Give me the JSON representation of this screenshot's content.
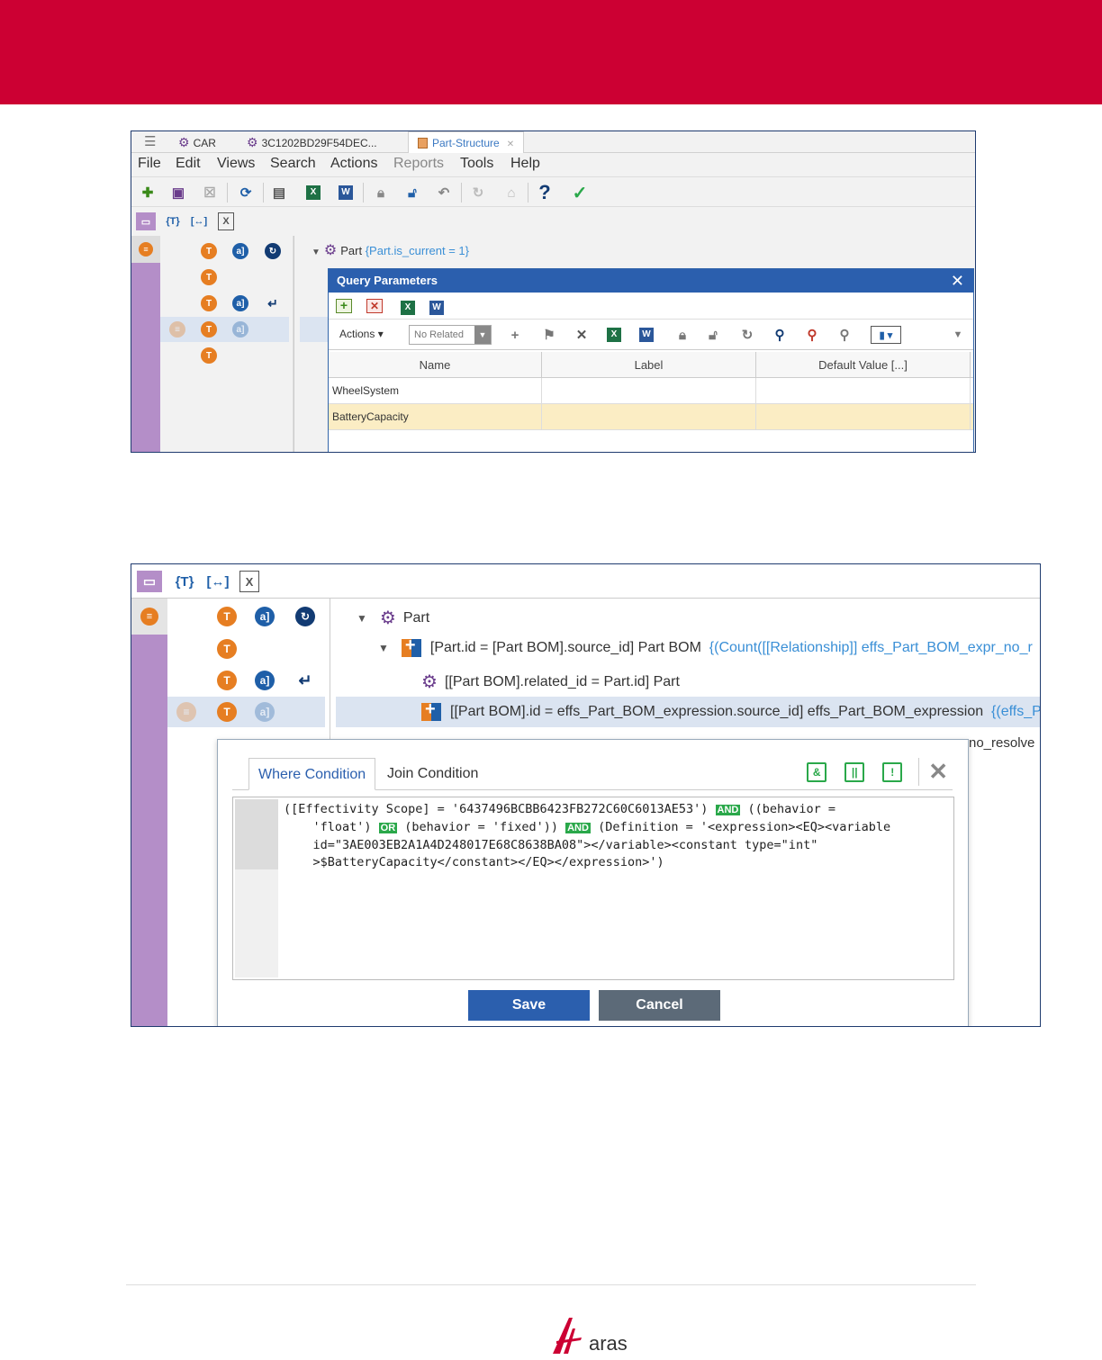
{
  "shot1": {
    "tabs": [
      {
        "label": "CAR"
      },
      {
        "label": "3C1202BD29F54DEC..."
      },
      {
        "label": "Part-Structure"
      }
    ],
    "menu": [
      "File",
      "Edit",
      "Views",
      "Search",
      "Actions",
      "Reports",
      "Tools",
      "Help"
    ],
    "tree_root": {
      "label": "Part",
      "condition": "{Part.is_current = 1}"
    },
    "dialog": {
      "title": "Query Parameters",
      "actions_label": "Actions",
      "no_related": "No Related",
      "columns": [
        "Name",
        "Label",
        "Default Value [...]"
      ],
      "rows": [
        {
          "name": "WheelSystem",
          "label": "",
          "default": ""
        },
        {
          "name": "BatteryCapacity",
          "label": "",
          "default": ""
        }
      ]
    }
  },
  "shot2": {
    "tree": [
      {
        "prefix": "",
        "label": "Part",
        "suffix": ""
      },
      {
        "prefix": "[Part.id = [Part BOM].source_id]",
        "label": "Part BOM",
        "suffix": "{(Count([[Relationship]] effs_Part_BOM_expr_no_r"
      },
      {
        "prefix": "[[Part BOM].related_id = Part.id]",
        "label": "Part",
        "suffix": ""
      },
      {
        "prefix": "[[Part BOM].id = effs_Part_BOM_expression.source_id]",
        "label": "effs_Part_BOM_expression",
        "suffix": "{(effs_P"
      },
      {
        "prefix": "",
        "label": "no_resolve",
        "suffix": ""
      }
    ],
    "popup": {
      "tab_where": "Where Condition",
      "tab_join": "Join Condition",
      "code": {
        "l1a": "([Effectivity Scope] = '6437496BCBB6423FB272C60C6013AE53') ",
        "and1": "AND",
        "l1b": " ((behavior =",
        "l2a": "    'float') ",
        "or1": "OR",
        "l2b": " (behavior = 'fixed')) ",
        "and2": "AND",
        "l2c": " (Definition = '<expression><EQ><variable",
        "l3": "    id=\"3AE003EB2A1A4D248017E68C8638BA08\"></variable><constant type=\"int\"",
        "l4": "    >$BatteryCapacity</constant></EQ></expression>')"
      },
      "save_label": "Save",
      "cancel_label": "Cancel"
    }
  },
  "footer": {
    "logo_text": "aras"
  },
  "colors": {
    "brand_red": "#cc0033",
    "dialog_blue": "#2b5fae",
    "accent_green": "#2aa84a"
  }
}
